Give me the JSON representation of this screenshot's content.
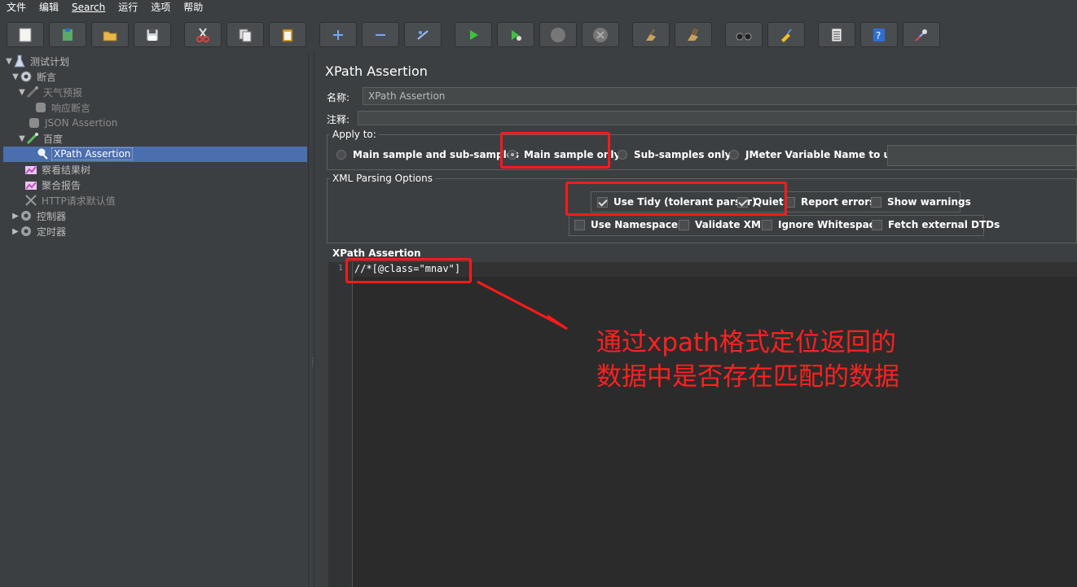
{
  "menubar": {
    "items": [
      "文件",
      "编辑",
      "Search",
      "运行",
      "选项",
      "帮助"
    ]
  },
  "toolbar": {
    "buttons": [
      {
        "icon": "new-icon"
      },
      {
        "icon": "templates-icon"
      },
      {
        "icon": "open-icon"
      },
      {
        "icon": "save-icon"
      },
      {
        "icon": "cut-icon"
      },
      {
        "icon": "copy-icon"
      },
      {
        "icon": "paste-icon"
      },
      {
        "icon": "expand-icon"
      },
      {
        "icon": "collapse-icon"
      },
      {
        "icon": "toggle-icon"
      },
      {
        "icon": "start-icon"
      },
      {
        "icon": "start-no-timers-icon"
      },
      {
        "icon": "stop-icon"
      },
      {
        "icon": "shutdown-icon"
      },
      {
        "icon": "clear-icon"
      },
      {
        "icon": "clear-all-icon"
      },
      {
        "icon": "search-binoculars-icon"
      },
      {
        "icon": "reset-search-icon"
      },
      {
        "icon": "function-helper-icon"
      },
      {
        "icon": "help-icon"
      },
      {
        "icon": "remote-icon"
      }
    ]
  },
  "tree": {
    "items": [
      {
        "label": "测试计划"
      },
      {
        "label": "断言"
      },
      {
        "label": "天气预报"
      },
      {
        "label": "响应断言"
      },
      {
        "label": "JSON Assertion"
      },
      {
        "label": "百度"
      },
      {
        "label": "XPath Assertion"
      },
      {
        "label": "察看结果树"
      },
      {
        "label": "聚合报告"
      },
      {
        "label": "HTTP请求默认值"
      },
      {
        "label": "控制器"
      },
      {
        "label": "定时器"
      }
    ]
  },
  "panel": {
    "title": "XPath Assertion",
    "name_label": "名称:",
    "name_value": "XPath Assertion",
    "comment_label": "注释:",
    "comment_value": "",
    "apply_to": {
      "title": "Apply to:",
      "options": [
        {
          "label": "Main sample and sub-samples",
          "selected": false
        },
        {
          "label": "Main sample only",
          "selected": true
        },
        {
          "label": "Sub-samples only",
          "selected": false
        },
        {
          "label": "JMeter Variable Name to use",
          "selected": false
        }
      ],
      "variable_value": ""
    },
    "xml_parsing": {
      "title": "XML Parsing Options",
      "checks": [
        {
          "label": "Use Tidy (tolerant parser)",
          "checked": true
        },
        {
          "label": "Quiet",
          "checked": true
        },
        {
          "label": "Report errors",
          "checked": false
        },
        {
          "label": "Show warnings",
          "checked": false
        },
        {
          "label": "Use Namespaces",
          "checked": false
        },
        {
          "label": "Validate XML",
          "checked": false
        },
        {
          "label": "Ignore Whitespace",
          "checked": false
        },
        {
          "label": "Fetch external DTDs",
          "checked": false
        }
      ]
    },
    "xpath_assertion": {
      "title": "XPath Assertion",
      "line_number": "1",
      "expression": "//*[@class=\"mnav\"]"
    }
  },
  "annotation": {
    "line1": "通过xpath格式定位返回的",
    "line2": "数据中是否存在匹配的数据",
    "color": "#ff2020"
  }
}
